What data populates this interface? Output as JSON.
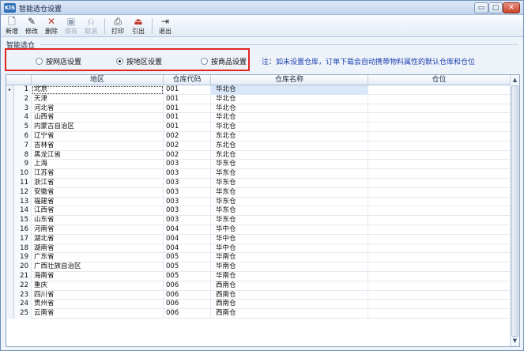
{
  "window": {
    "app_icon": "KIS",
    "title": "智能选仓设置"
  },
  "titlebar_buttons": {
    "minimize": "▭",
    "maximize": "▢",
    "close": "✕"
  },
  "toolbar": [
    {
      "name": "new",
      "icon": "🗋",
      "label": "新增",
      "disabled": false
    },
    {
      "name": "edit",
      "icon": "✎",
      "label": "修改",
      "disabled": false
    },
    {
      "name": "delete",
      "icon": "✕",
      "label": "删除",
      "disabled": false
    },
    {
      "name": "save",
      "icon": "▣",
      "label": "保存",
      "disabled": true
    },
    {
      "name": "cancel",
      "icon": "⎌",
      "label": "取消",
      "disabled": true
    },
    {
      "name": "print",
      "icon": "⎙",
      "label": "打印",
      "disabled": false
    },
    {
      "name": "export",
      "icon": "⏏",
      "label": "引出",
      "disabled": false
    },
    {
      "name": "exit",
      "icon": "⇥",
      "label": "退出",
      "disabled": false
    }
  ],
  "group": {
    "label": "智能选仓"
  },
  "radios": [
    {
      "label": "按网店设置",
      "selected": false
    },
    {
      "label": "按地区设置",
      "selected": true
    },
    {
      "label": "按商品设置",
      "selected": false
    }
  ],
  "note": "注：如未设置仓库，订单下载会自动携带物料属性的默认仓库和仓位",
  "grid": {
    "columns": [
      "地区",
      "仓库代码",
      "仓库名称",
      "仓位"
    ],
    "rows": [
      [
        "1",
        "北京",
        "001",
        "华北仓",
        ""
      ],
      [
        "2",
        "天津",
        "001",
        "华北仓",
        ""
      ],
      [
        "3",
        "河北省",
        "001",
        "华北仓",
        ""
      ],
      [
        "4",
        "山西省",
        "001",
        "华北仓",
        ""
      ],
      [
        "5",
        "内蒙古自治区",
        "001",
        "华北仓",
        ""
      ],
      [
        "6",
        "辽宁省",
        "002",
        "东北仓",
        ""
      ],
      [
        "7",
        "吉林省",
        "002",
        "东北仓",
        ""
      ],
      [
        "8",
        "黑龙江省",
        "002",
        "东北仓",
        ""
      ],
      [
        "9",
        "上海",
        "003",
        "华东仓",
        ""
      ],
      [
        "10",
        "江苏省",
        "003",
        "华东仓",
        ""
      ],
      [
        "11",
        "浙江省",
        "003",
        "华东仓",
        ""
      ],
      [
        "12",
        "安徽省",
        "003",
        "华东仓",
        ""
      ],
      [
        "13",
        "福建省",
        "003",
        "华东仓",
        ""
      ],
      [
        "14",
        "江西省",
        "003",
        "华东仓",
        ""
      ],
      [
        "15",
        "山东省",
        "003",
        "华东仓",
        ""
      ],
      [
        "16",
        "河南省",
        "004",
        "华中仓",
        ""
      ],
      [
        "17",
        "湖北省",
        "004",
        "华中仓",
        ""
      ],
      [
        "18",
        "湖南省",
        "004",
        "华中仓",
        ""
      ],
      [
        "19",
        "广东省",
        "005",
        "华南仓",
        ""
      ],
      [
        "20",
        "广西壮族自治区",
        "005",
        "华南仓",
        ""
      ],
      [
        "21",
        "海南省",
        "005",
        "华南仓",
        ""
      ],
      [
        "22",
        "重庆",
        "006",
        "西南仓",
        ""
      ],
      [
        "23",
        "四川省",
        "006",
        "西南仓",
        ""
      ],
      [
        "24",
        "贵州省",
        "006",
        "西南仓",
        ""
      ],
      [
        "25",
        "云南省",
        "006",
        "西南仓",
        ""
      ]
    ],
    "current_row_marker": "▸",
    "scroll_up": "▲",
    "scroll_down": "▼"
  }
}
